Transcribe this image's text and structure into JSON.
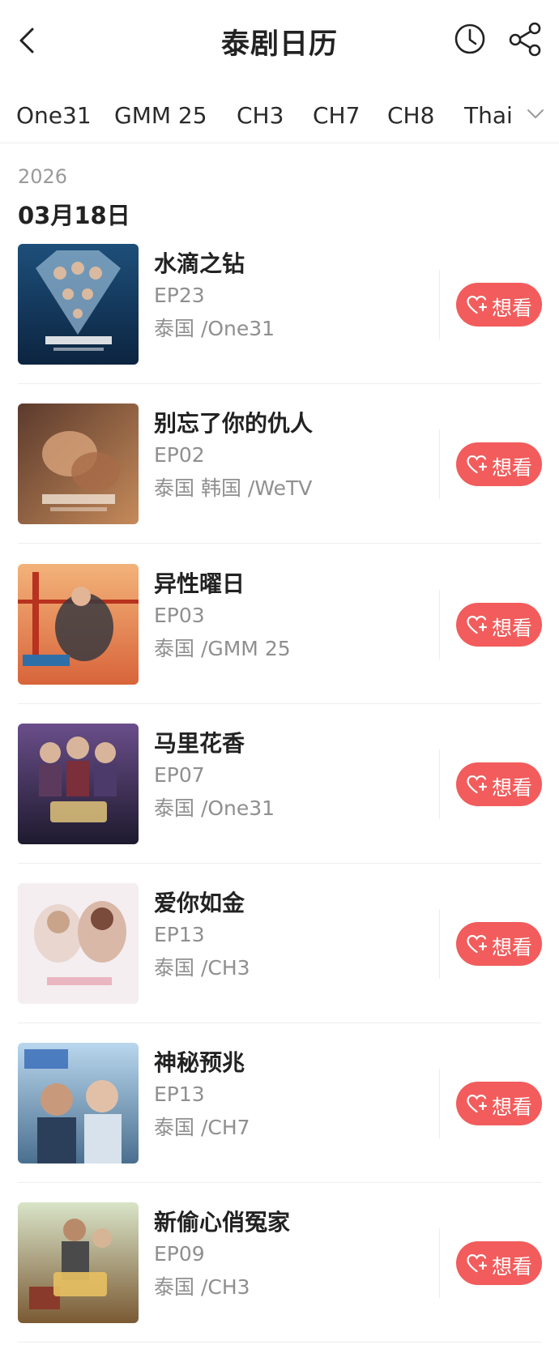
{
  "header": {
    "title": "泰剧日历"
  },
  "tabs": [
    "One31",
    "GMM 25",
    "CH3",
    "CH7",
    "CH8",
    "Thai"
  ],
  "schedule": {
    "year": "2026",
    "date": "03月18日"
  },
  "want_label": "想看",
  "items": [
    {
      "name": "水滴之钻",
      "episode": "EP23",
      "meta": "泰国 /One31"
    },
    {
      "name": "别忘了你的仇人",
      "episode": "EP02",
      "meta": "泰国 韩国 /WeTV"
    },
    {
      "name": "异性曜日",
      "episode": "EP03",
      "meta": "泰国 /GMM 25"
    },
    {
      "name": "马里花香",
      "episode": "EP07",
      "meta": "泰国 /One31"
    },
    {
      "name": "爱你如金",
      "episode": "EP13",
      "meta": "泰国 /CH3"
    },
    {
      "name": "神秘预兆",
      "episode": "EP13",
      "meta": "泰国 /CH7"
    },
    {
      "name": "新偷心俏冤家",
      "episode": "EP09",
      "meta": "泰国 /CH3"
    }
  ],
  "colors": {
    "accent": "#f25c5c",
    "muted": "#8f8f8f",
    "divider": "#eeeeee"
  },
  "icons": [
    "back-arrow-icon",
    "clock-icon",
    "share-icon",
    "chevron-down-icon",
    "heart-plus-icon"
  ]
}
